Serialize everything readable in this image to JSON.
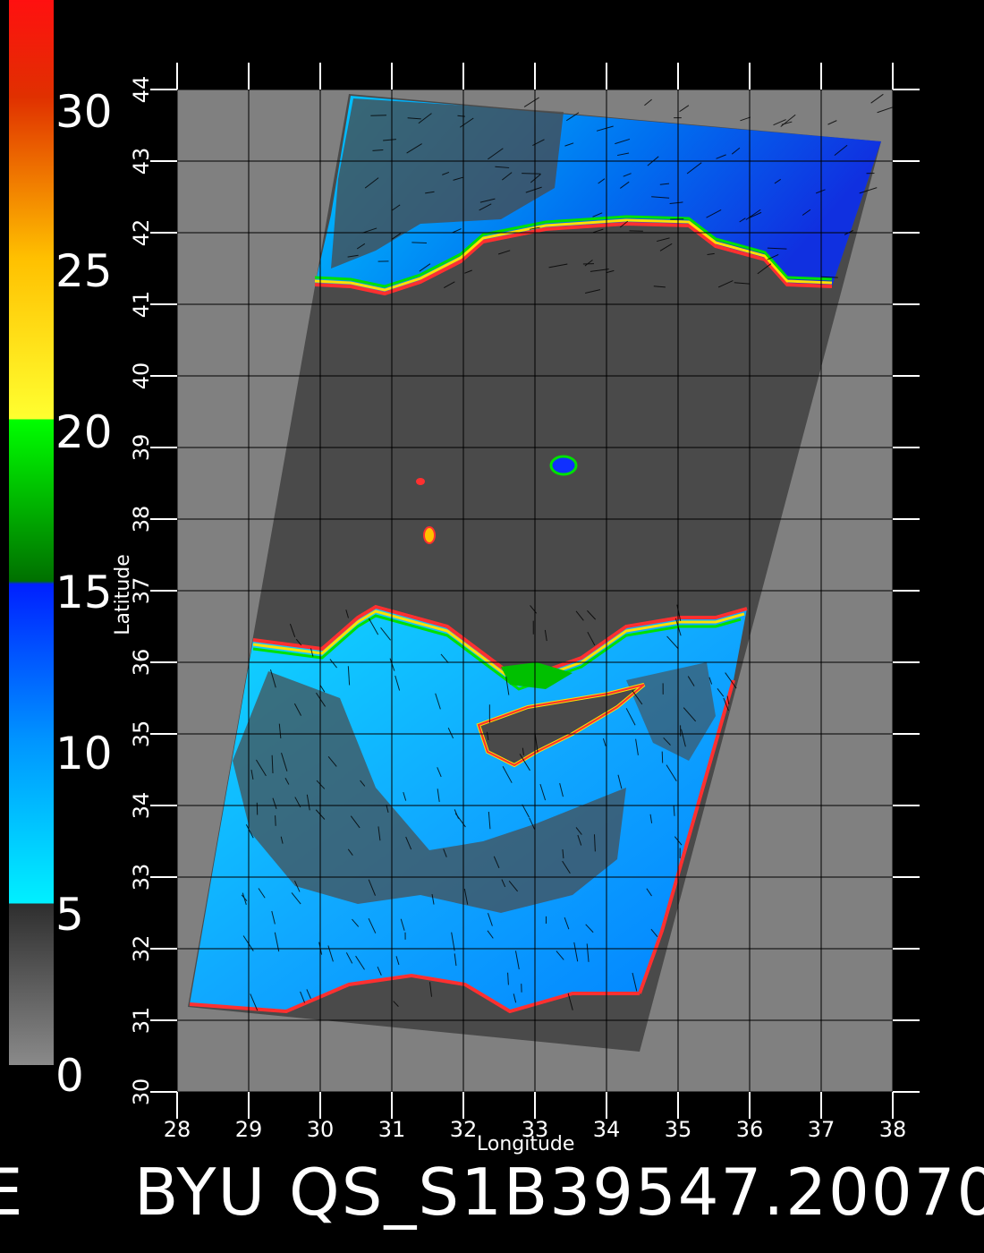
{
  "colorbar": {
    "labels": [
      "30",
      "25",
      "20",
      "15",
      "10",
      "5",
      "0"
    ],
    "stops": [
      {
        "value": 0,
        "color": "#8a8a8a"
      },
      {
        "value": 5,
        "color": "#2e2e2e"
      },
      {
        "value": 5.01,
        "color": "#00f0ff"
      },
      {
        "value": 10,
        "color": "#0096ff"
      },
      {
        "value": 14.9,
        "color": "#0020ff"
      },
      {
        "value": 15,
        "color": "#007000"
      },
      {
        "value": 20,
        "color": "#00ff00"
      },
      {
        "value": 20.01,
        "color": "#ffff30"
      },
      {
        "value": 25,
        "color": "#ffc000"
      },
      {
        "value": 30,
        "color": "#e03000"
      },
      {
        "value": 33,
        "color": "#ff1010"
      }
    ]
  },
  "map": {
    "xlabel": "Longitude",
    "ylabel": "Latitude",
    "x_ticks": [
      "28",
      "29",
      "30",
      "31",
      "32",
      "33",
      "34",
      "35",
      "36",
      "37",
      "38"
    ],
    "y_ticks": [
      "30",
      "31",
      "32",
      "33",
      "34",
      "35",
      "36",
      "37",
      "38",
      "39",
      "40",
      "41",
      "42",
      "43",
      "44"
    ],
    "lon_range": [
      28,
      38
    ],
    "lat_range": [
      30,
      44
    ],
    "colors": {
      "background": "#000000",
      "outside_swath": "#808080",
      "land": "#4a4a4a",
      "grid": "#000000"
    }
  },
  "title": "BYU QS_S1B39547.20070",
  "left_mark": "E"
}
